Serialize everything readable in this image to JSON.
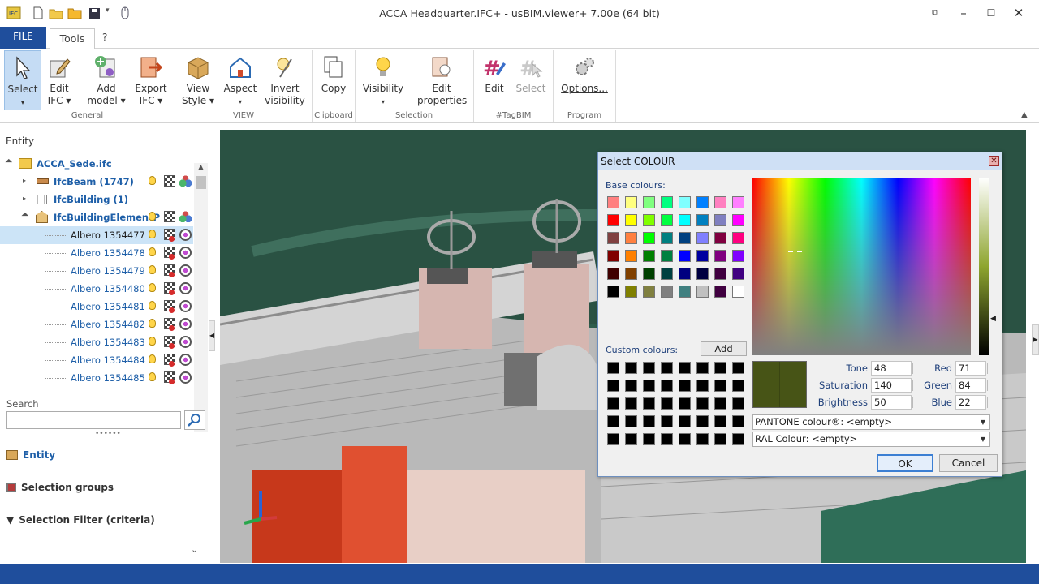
{
  "window": {
    "title": "ACCA Headquarter.IFC+ - usBIM.viewer+  7.00e (64 bit)"
  },
  "tabs": {
    "file": "FILE",
    "tools": "Tools",
    "help": "?"
  },
  "ribbon": {
    "select": "Select",
    "edit_ifc": [
      "Edit",
      "IFC"
    ],
    "add_model": [
      "Add",
      "model"
    ],
    "export_ifc": [
      "Export",
      "IFC"
    ],
    "view_style": [
      "View",
      "Style"
    ],
    "aspect": "Aspect",
    "invert_visibility": [
      "Invert",
      "visibility"
    ],
    "copy": "Copy",
    "visibility": "Visibility",
    "edit_properties": [
      "Edit",
      "properties"
    ],
    "tag_edit": "Edit",
    "tag_select": "Select",
    "options": "Options...",
    "groups": {
      "general": "General",
      "view": "VIEW",
      "clipboard": "Clipboard",
      "selection": "Selection",
      "tagbim": "#TagBIM",
      "program": "Program"
    }
  },
  "panel": {
    "title": "Entity",
    "tree": [
      {
        "label": "ACCA_Sede.ifc"
      },
      {
        "label": "IfcBeam (1747)"
      },
      {
        "label": "IfcBuilding (1)"
      },
      {
        "label": "IfcBuildingElementP"
      },
      {
        "label": "Albero 1354477"
      },
      {
        "label": "Albero 1354478"
      },
      {
        "label": "Albero 1354479"
      },
      {
        "label": "Albero 1354480"
      },
      {
        "label": "Albero 1354481"
      },
      {
        "label": "Albero 1354482"
      },
      {
        "label": "Albero 1354483"
      },
      {
        "label": "Albero 1354484"
      },
      {
        "label": "Albero 1354485"
      }
    ],
    "search_label": "Search",
    "search_value": "",
    "accordion": {
      "entity": "Entity",
      "selection_groups": "Selection groups",
      "selection_filter": "Selection Filter (criteria)"
    }
  },
  "dialog": {
    "title": "Select COLOUR",
    "base_colours_label": "Base colours:",
    "custom_colours_label": "Custom colours:",
    "add_button": "Add",
    "base_colours": [
      "#ff8080",
      "#ffff80",
      "#80ff80",
      "#00ff80",
      "#80ffff",
      "#0080ff",
      "#ff80c0",
      "#ff80ff",
      "#ff0000",
      "#ffff00",
      "#80ff00",
      "#00ff40",
      "#00ffff",
      "#0080c0",
      "#8080c0",
      "#ff00ff",
      "#804040",
      "#ff8040",
      "#00ff00",
      "#008080",
      "#004080",
      "#8080ff",
      "#800040",
      "#ff0080",
      "#800000",
      "#ff8000",
      "#008000",
      "#008040",
      "#0000ff",
      "#0000a0",
      "#800080",
      "#8000ff",
      "#400000",
      "#804000",
      "#004000",
      "#004040",
      "#000080",
      "#000040",
      "#400040",
      "#400080",
      "#000000",
      "#808000",
      "#808040",
      "#808080",
      "#408080",
      "#c0c0c0",
      "#400040",
      "#ffffff"
    ],
    "preview_colour": "#475416",
    "tone_label": "Tone",
    "tone": "48",
    "saturation_label": "Saturation",
    "saturation": "140",
    "brightness_label": "Brightness",
    "brightness": "50",
    "red_label": "Red",
    "red": "71",
    "green_label": "Green",
    "green": "84",
    "blue_label": "Blue",
    "blue": "22",
    "pantone": "PANTONE colour®: <empty>",
    "ral": "RAL Colour: <empty>",
    "ok": "OK",
    "cancel": "Cancel"
  }
}
